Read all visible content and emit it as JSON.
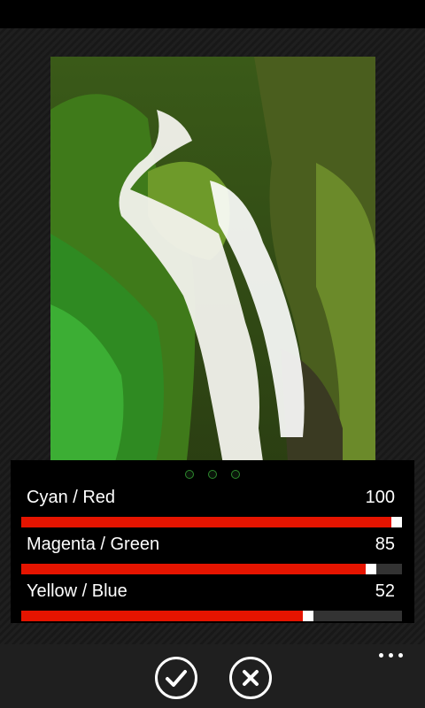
{
  "sliders": [
    {
      "label": "Cyan / Red",
      "value": 100,
      "fraction": 1.0
    },
    {
      "label": "Magenta / Green",
      "value": 85,
      "fraction": 0.93
    },
    {
      "label": "Yellow / Blue",
      "value": 52,
      "fraction": 0.76
    }
  ],
  "pager": {
    "count": 3
  },
  "app_bar": {
    "confirm_icon": "check-icon",
    "cancel_icon": "close-icon",
    "more_icon": "ellipsis-icon"
  },
  "colors": {
    "accent": "#e51400",
    "track": "#333333",
    "pager_dot": "#2d8a2d"
  }
}
